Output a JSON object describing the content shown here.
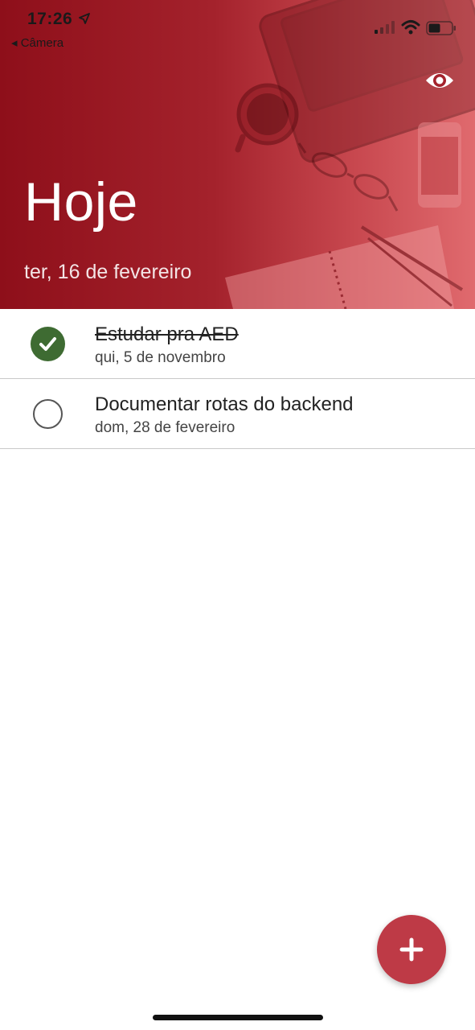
{
  "status_bar": {
    "time": "17:26",
    "back_app": "◂ Câmera"
  },
  "header": {
    "title": "Hoje",
    "date": "ter, 16 de fevereiro",
    "visibility_icon": "eye-icon",
    "background_color": "#a4222c"
  },
  "tasks": [
    {
      "title": "Estudar pra AED",
      "date": "qui, 5 de novembro",
      "completed": true
    },
    {
      "title": "Documentar rotas do backend",
      "date": "dom, 28 de fevereiro",
      "completed": false
    }
  ],
  "fab": {
    "icon": "plus-icon",
    "color": "#be3a46"
  },
  "colors": {
    "done": "#3e6b32",
    "accent": "#be3a46"
  }
}
